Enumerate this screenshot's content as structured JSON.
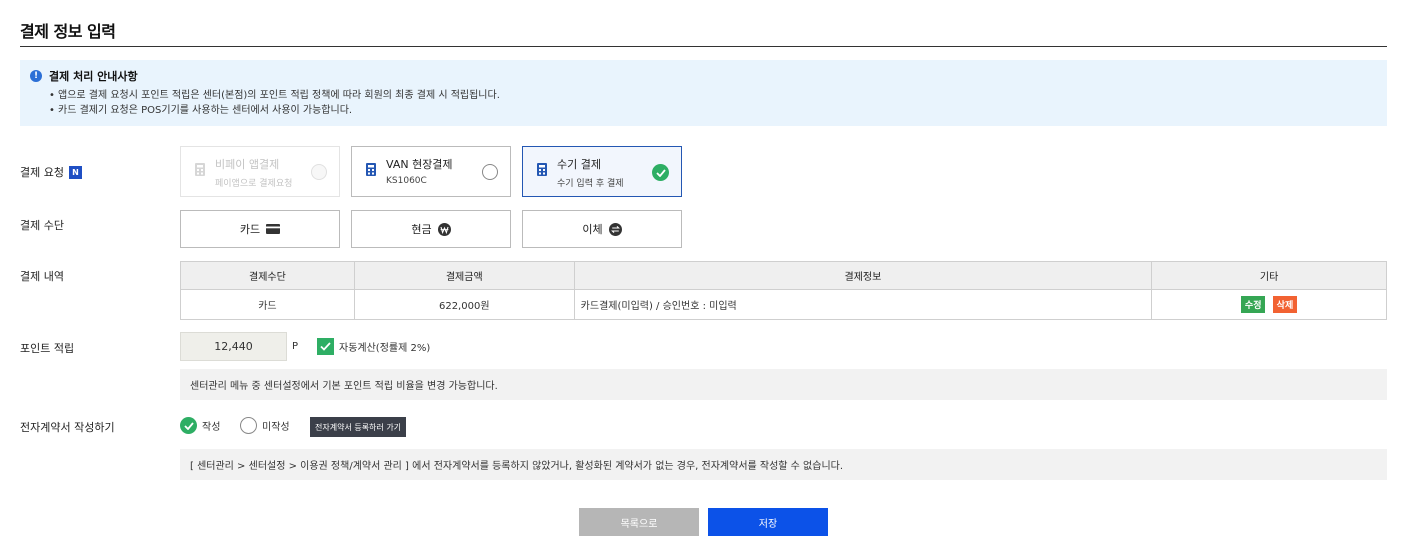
{
  "page": {
    "title": "결제 정보 입력"
  },
  "notice": {
    "title": "결제 처리 안내사항",
    "items": [
      "앱으로 결제 요청시 포인트 적립은 센터(본점)의 포인트 적립 정책에 따라 회원의 최종 결제 시 적립됩니다.",
      "카드 결제기 요청은 POS기기를 사용하는 센터에서 사용이 가능합니다."
    ]
  },
  "payment_request": {
    "label": "결제 요청",
    "badge": "N",
    "options": [
      {
        "title": "비페이 앱결제",
        "sub": "페이앱으로 결제요청",
        "state": "disabled"
      },
      {
        "title": "VAN 현장결제",
        "sub": "KS1060C",
        "state": "unselected"
      },
      {
        "title": "수기 결제",
        "sub": "수기 입력 후 결제",
        "state": "selected"
      }
    ]
  },
  "payment_method": {
    "label": "결제 수단",
    "options": [
      {
        "label": "카드",
        "icon": "card-icon"
      },
      {
        "label": "현금",
        "icon": "won-icon"
      },
      {
        "label": "이체",
        "icon": "transfer-icon"
      }
    ]
  },
  "payment_history": {
    "label": "결제 내역",
    "columns": [
      "결제수단",
      "결제금액",
      "결제정보",
      "기타"
    ],
    "rows": [
      {
        "method": "카드",
        "amount": "622,000원",
        "info": "카드결제(미입력) / 승인번호 : 미입력",
        "edit": "수정",
        "delete": "삭제"
      }
    ]
  },
  "points": {
    "label": "포인트 적립",
    "value": "12,440",
    "unit": "P",
    "auto_label": "자동계산(정률제 2%)",
    "hint": "센터관리 메뉴 중 센터설정에서 기본 포인트 적립 비율을 변경 가능합니다."
  },
  "contract": {
    "label": "전자계약서 작성하기",
    "write": "작성",
    "not_write": "미작성",
    "goto_button": "전자계약서 등록하러 가기",
    "hint": "[ 센터관리 > 센터설정 > 이용권 정책/계약서 관리 ] 에서 전자계약서를 등록하지 않았거나, 활성화된 계약서가 없는 경우, 전자계약서를 작성할 수 없습니다."
  },
  "actions": {
    "list": "목록으로",
    "save": "저장"
  },
  "colors": {
    "primary": "#0c52e8",
    "success": "#2eae64",
    "danger": "#f26232",
    "notice_bg": "#e9f4fd"
  }
}
